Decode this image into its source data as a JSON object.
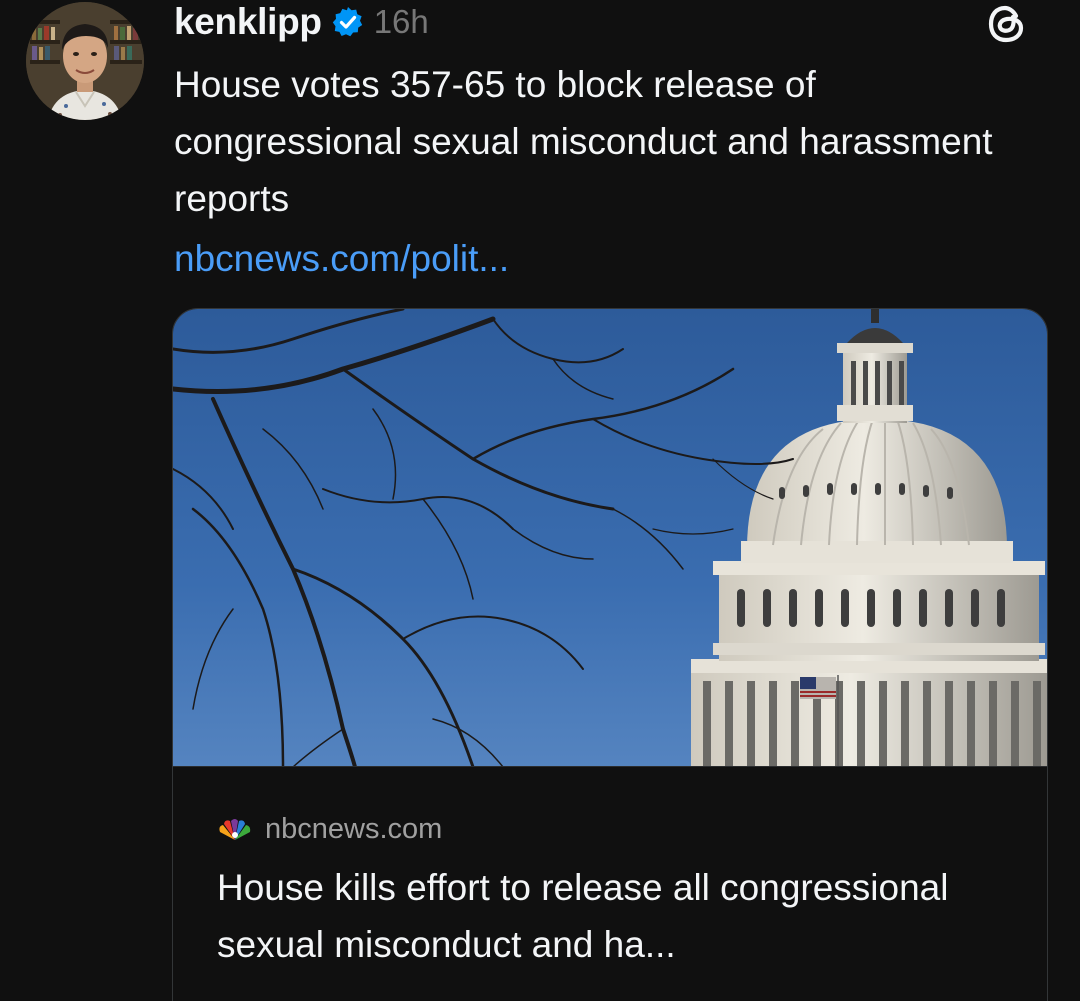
{
  "post": {
    "username": "kenklipp",
    "timestamp": "16h",
    "text": "House votes 357-65 to block release of congressional sexual misconduct and harassment reports",
    "link": "nbcnews.com/polit..."
  },
  "link_card": {
    "source_domain": "nbcnews.com",
    "title": "House kills effort to release all congressional sexual misconduct and ha..."
  },
  "icons": {
    "verified": "verified-badge-icon",
    "app_logo": "threads-logo-icon",
    "source": "nbc-peacock-icon"
  },
  "colors": {
    "background": "#101010",
    "text": "#f3f5f7",
    "secondary_text": "#777777",
    "link": "#4a9df8",
    "verified": "#0095f6"
  }
}
